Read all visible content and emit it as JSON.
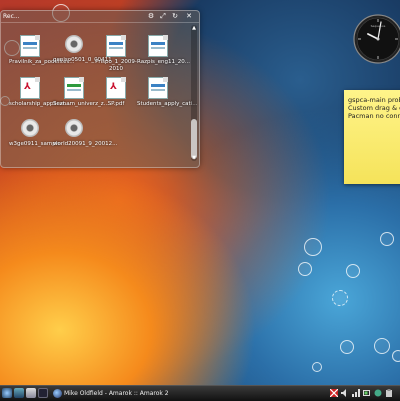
{
  "folder_view": {
    "title": "Rec...",
    "items": [
      {
        "label": "Pravilnik_za_podelitev...",
        "type": "doc"
      },
      {
        "label": "geniso0501_0_00411",
        "type": "gear"
      },
      {
        "label": "Prispo_1_2009-2010",
        "type": "doc"
      },
      {
        "label": "Razpis_eng11_20...",
        "type": "doc"
      },
      {
        "label": "scholarship_applicat...",
        "type": "pdf"
      },
      {
        "label": "Seznam_univerz_z...",
        "type": "sheet"
      },
      {
        "label": "SP.pdf",
        "type": "pdf"
      },
      {
        "label": "Students_apply_cati...",
        "type": "doc"
      },
      {
        "label": "w3ge0911_sample",
        "type": "gear"
      },
      {
        "label": "world20091_9_20012...",
        "type": "gear"
      }
    ]
  },
  "clock": {
    "brand": "Sequence",
    "hour": 10,
    "minute": 7
  },
  "note": {
    "lines": [
      "gspca-main proble...",
      "Custom drag & dr...",
      "Pacman no conne..."
    ]
  },
  "taskbar": {
    "tasks": [
      {
        "label": "Mike Oldfield - Amarok :: Amarok 2"
      }
    ]
  },
  "colors": {
    "taskbar_bg": "#111111",
    "note_yellow": "#f5e35a"
  }
}
